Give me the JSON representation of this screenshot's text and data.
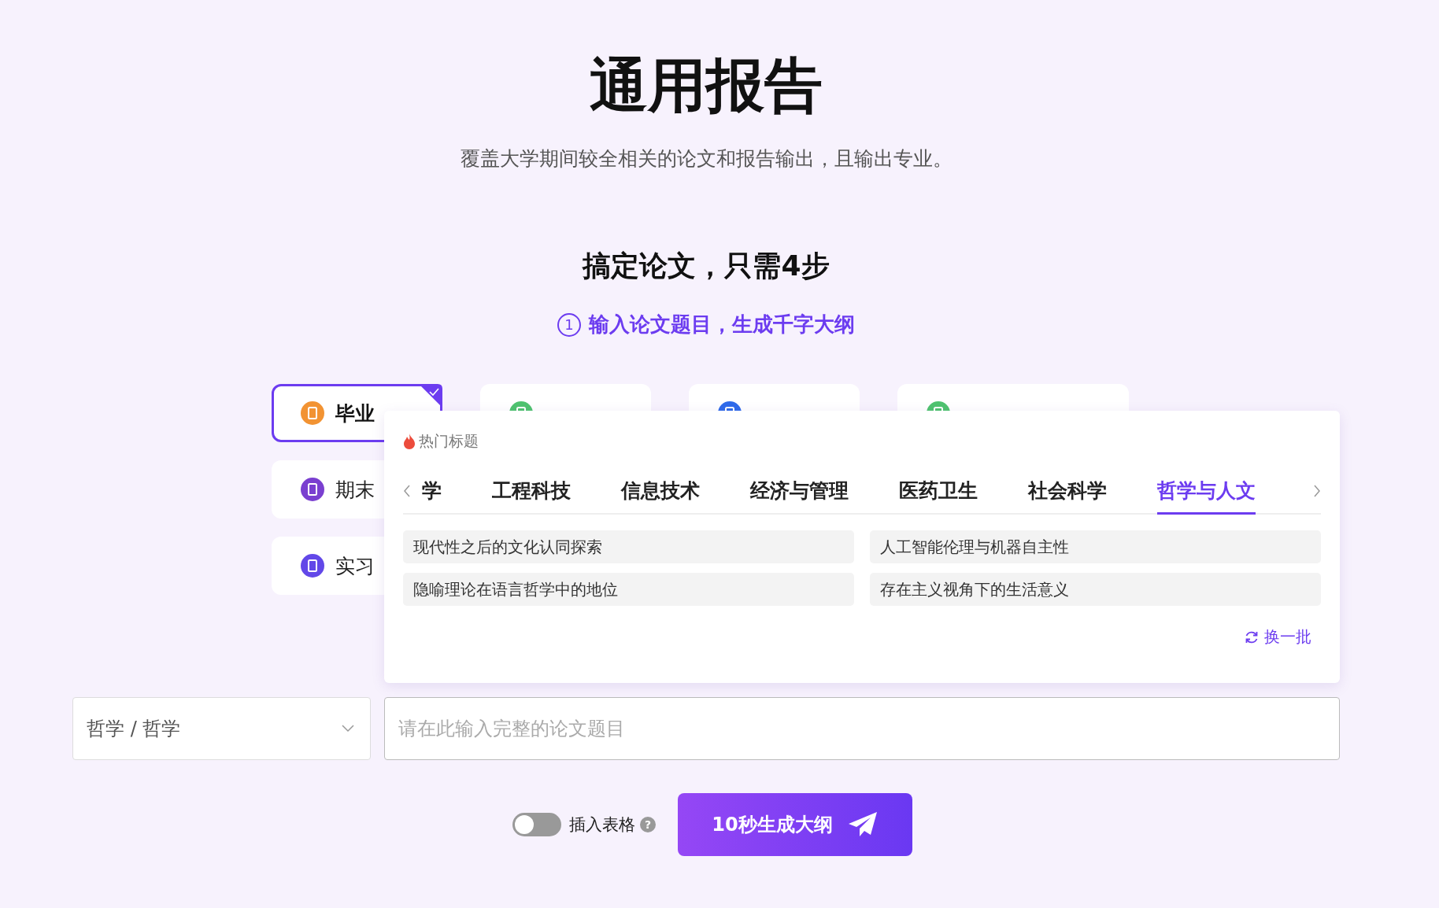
{
  "header": {
    "title": "通用报告",
    "subtitle": "覆盖大学期间较全相关的论文和报告输出，且输出专业。"
  },
  "steps": {
    "heading": "搞定论文，只需4步",
    "number": "1",
    "label": "输入论文题目，生成千字大纲"
  },
  "paper_types": [
    {
      "label": "毕业",
      "color": "#f29333",
      "selected": true
    },
    {
      "color": "#4fc36f",
      "selected": false
    },
    {
      "color": "#2f6bea",
      "selected": false
    },
    {
      "color": "#4fc36f",
      "selected": false
    },
    {
      "label": "期末",
      "color": "#7a3fd0",
      "selected": false
    },
    {
      "label": "实习",
      "color": "#6248e8",
      "selected": false
    }
  ],
  "hot_titles": {
    "heading": "热门标题",
    "tabs": [
      {
        "label": "学",
        "selected": false
      },
      {
        "label": "工程科技",
        "selected": false
      },
      {
        "label": "信息技术",
        "selected": false
      },
      {
        "label": "经济与管理",
        "selected": false
      },
      {
        "label": "医药卫生",
        "selected": false
      },
      {
        "label": "社会科学",
        "selected": false
      },
      {
        "label": "哲学与人文",
        "selected": true
      }
    ],
    "suggestions": [
      "现代性之后的文化认同探索",
      "人工智能伦理与机器自主性",
      "隐喻理论在语言哲学中的地位",
      "存在主义视角下的生活意义"
    ],
    "refresh": "换一批"
  },
  "subject_select": {
    "value": "哲学 / 哲学"
  },
  "title_input": {
    "placeholder": "请在此输入完整的论文题目"
  },
  "insert_table": {
    "label": "插入表格",
    "on": false,
    "help": "?"
  },
  "generate_button": {
    "label": "10秒生成大纲"
  }
}
